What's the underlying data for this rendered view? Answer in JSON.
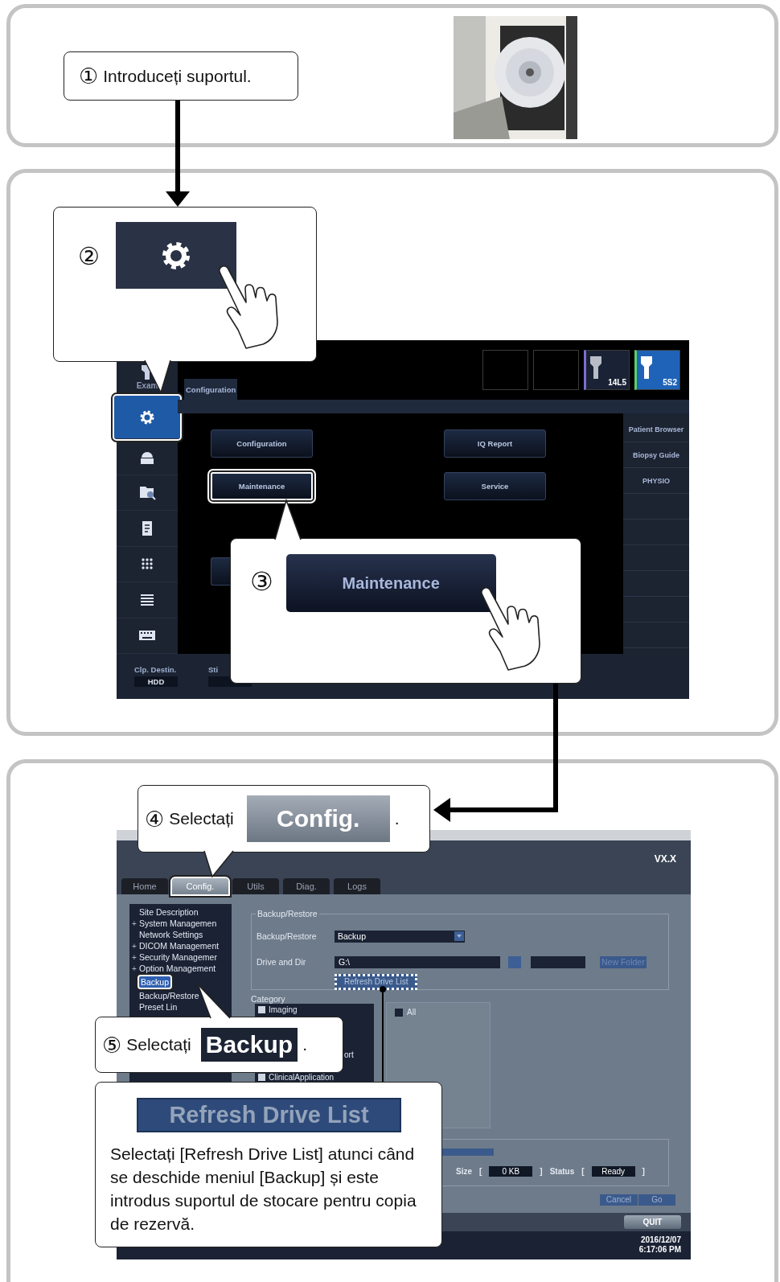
{
  "panel_1": {
    "callout": {
      "number": "①",
      "text": "Introduceți suportul."
    }
  },
  "panel_2": {
    "callout_2": {
      "number": "②"
    },
    "screen": {
      "sidebar": [
        {
          "label": "Exam",
          "selected": false
        },
        {
          "selected": true
        },
        {
          "selected": false
        },
        {
          "selected": false
        },
        {
          "selected": false
        },
        {
          "selected": false
        },
        {
          "selected": false
        },
        {
          "selected": false
        }
      ],
      "tabs": [
        {
          "label": "Configuration",
          "selected": true
        }
      ],
      "probes": [
        {
          "kind": "empty"
        },
        {
          "kind": "empty"
        },
        {
          "kind": "probe",
          "label": "14L5",
          "selected": false
        },
        {
          "kind": "probe",
          "label": "5S2",
          "selected": true
        }
      ],
      "buttons": [
        {
          "label": "Configuration",
          "highlighted": false
        },
        {
          "label": "IQ Report",
          "highlighted": false
        },
        {
          "label": "Maintenance",
          "highlighted": true
        },
        {
          "label": "Service",
          "highlighted": false
        }
      ],
      "right_panel": [
        "Patient Browser",
        "Biopsy Guide",
        "PHYSIO"
      ],
      "bottom_bar": [
        {
          "label": "Clp. Destin.",
          "value": "HDD"
        },
        {
          "label": "Sti"
        }
      ]
    },
    "callout_3": {
      "number": "③",
      "button": "Maintenance"
    }
  },
  "panel_3": {
    "callout_4": {
      "number": "④",
      "text": "Selectați",
      "button": "Config.",
      "end": "."
    },
    "screen": {
      "version": "VX.X",
      "tabs": [
        {
          "label": "Home",
          "selected": false
        },
        {
          "label": "Config.",
          "selected": true
        },
        {
          "label": "Utils",
          "selected": false
        },
        {
          "label": "Diag.",
          "selected": false
        },
        {
          "label": "Logs",
          "selected": false
        }
      ],
      "tree": [
        {
          "label": "Site Description",
          "selected": false
        },
        {
          "expander": "+",
          "label": "System Managemen",
          "selected": false
        },
        {
          "label": "Network Settings",
          "selected": false
        },
        {
          "expander": "+",
          "label": "DICOM Management",
          "selected": false
        },
        {
          "expander": "+",
          "label": "Security Managemer",
          "selected": false
        },
        {
          "expander": "+",
          "label": "Option Management",
          "selected": false
        },
        {
          "label": "Backup",
          "selected": true
        },
        {
          "label": "Backup/Restore",
          "selected": false
        },
        {
          "label": "Preset Lin",
          "selected": false
        }
      ],
      "backup_restore": {
        "title": "Backup/Restore",
        "mode_label": "Backup/Restore",
        "mode_value": "Backup",
        "drive_label": "Drive and Dir",
        "drive_value": "G:\\",
        "new_folder_button": "New Folder",
        "refresh_button": {
          "label": "Refresh Drive List",
          "highlighted": true
        }
      },
      "category": {
        "title": "Category",
        "items": [
          {
            "kind": "item",
            "label": "Imaging",
            "checked": true
          },
          {
            "kind": "fragment",
            "label": "ort"
          },
          {
            "kind": "item",
            "label": "ClinicalApplication",
            "checked": true
          }
        ],
        "filter": {
          "label": "All",
          "checked": true
        }
      },
      "progress": {
        "level": 0
      },
      "readouts": [
        {
          "label": "Size",
          "open": "[",
          "value": "0 KB",
          "close": "]"
        },
        {
          "label": "Status",
          "open": "[",
          "value": "Ready",
          "close": "]"
        }
      ],
      "actions": [
        "Cancel",
        "Go"
      ],
      "quit": "QUIT",
      "date": "2016/12/07",
      "time": "6:17:06 PM"
    },
    "callout_5": {
      "number": "⑤",
      "text": "Selectați",
      "button": "Backup",
      "end": "."
    },
    "callout_6": {
      "button": "Refresh Drive List",
      "text": "Selectați [Refresh Drive List] atunci când se deschide meniul [Backup] și este introdus suportul de stocare pentru copia de rezervă."
    }
  }
}
